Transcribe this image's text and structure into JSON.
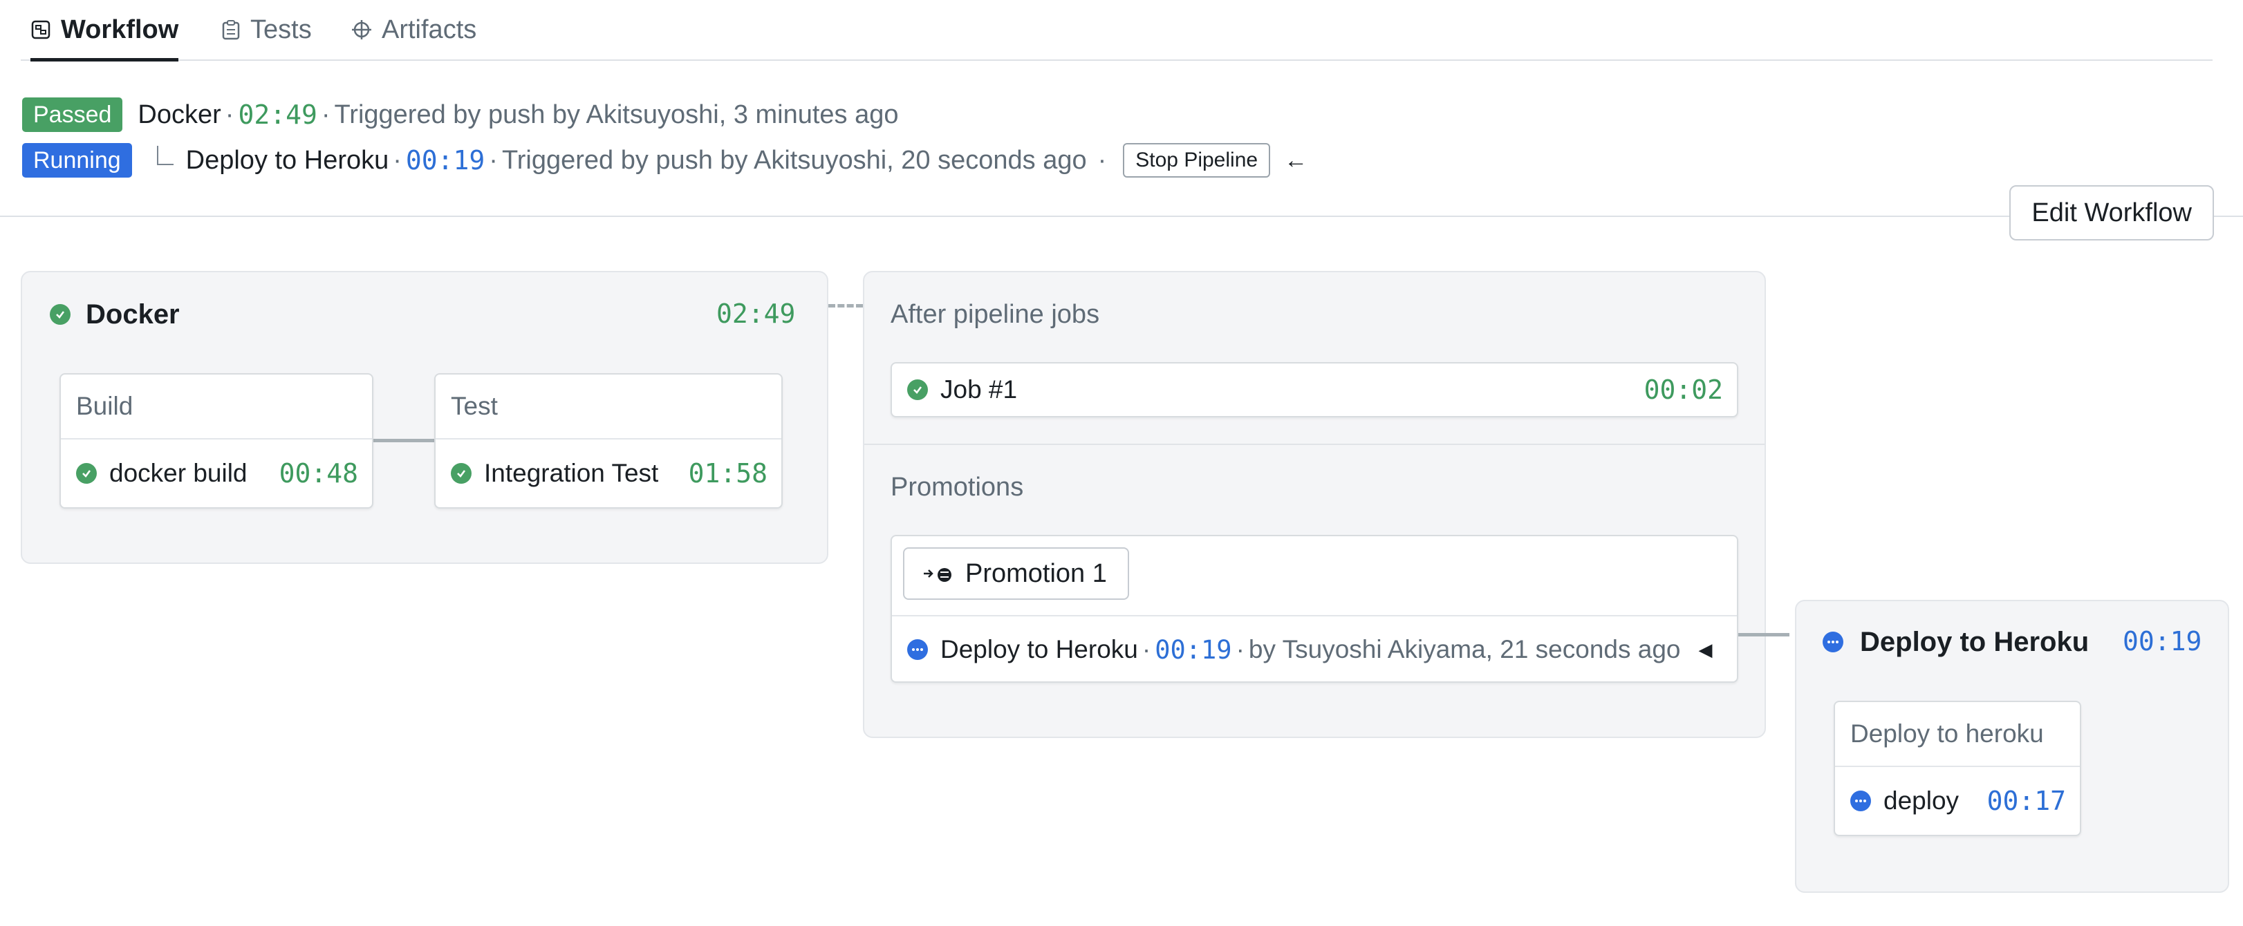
{
  "tabs": [
    {
      "label": "Workflow",
      "icon": "workflow-icon",
      "active": true
    },
    {
      "label": "Tests",
      "icon": "clipboard-icon",
      "active": false
    },
    {
      "label": "Artifacts",
      "icon": "artifacts-icon",
      "active": false
    }
  ],
  "pipelines": [
    {
      "status": "Passed",
      "name": "Docker",
      "duration": "02:49",
      "trigger": "Triggered by push by Akitsuyoshi, 3 minutes ago"
    },
    {
      "status": "Running",
      "name": "Deploy to Heroku",
      "duration": "00:19",
      "trigger": "Triggered by push by Akitsuyoshi, 20 seconds ago",
      "stop_label": "Stop Pipeline",
      "back_icon": "arrow-left-icon"
    }
  ],
  "edit_workflow_label": "Edit Workflow",
  "docker_block": {
    "title": "Docker",
    "duration": "02:49",
    "blocks": [
      {
        "name": "Build",
        "job": "docker build",
        "duration": "00:48"
      },
      {
        "name": "Test",
        "job": "Integration Test",
        "duration": "01:58"
      }
    ]
  },
  "after_pipeline": {
    "label": "After pipeline jobs",
    "job": {
      "name": "Job #1",
      "duration": "00:02"
    }
  },
  "promotions": {
    "label": "Promotions",
    "button_label": "Promotion 1",
    "entry": {
      "name": "Deploy to Heroku",
      "duration": "00:19",
      "by": "by Tsuyoshi Akiyama, 21 seconds ago"
    }
  },
  "heroku_block": {
    "title": "Deploy to Heroku",
    "duration": "00:19",
    "block": {
      "name": "Deploy to heroku",
      "job": "deploy",
      "duration": "00:17"
    }
  },
  "colors": {
    "passed": "#48a064",
    "running": "#2f6ee0",
    "time_green": "#3e9a5e",
    "time_blue": "#2d6fd6"
  }
}
